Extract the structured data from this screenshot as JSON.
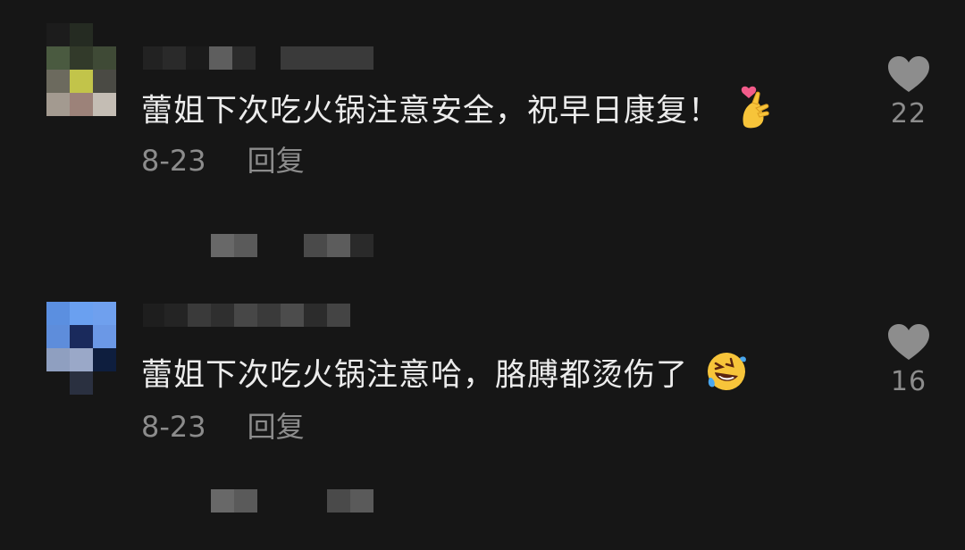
{
  "comments": [
    {
      "text": "蕾姐下次吃火锅注意安全，祝早日康复！",
      "emoji": "finger-heart-emoji",
      "date": "8-23",
      "reply_label": "回复",
      "like_count": "22"
    },
    {
      "text": "蕾姐下次吃火锅注意哈，胳膊都烫伤了",
      "emoji": "rolling-laughing-emoji",
      "date": "8-23",
      "reply_label": "回复",
      "like_count": "16"
    }
  ],
  "icons": {
    "like": "heart-icon"
  },
  "colors": {
    "background": "#161616",
    "text": "#ececec",
    "secondary_text": "#8c8c8c",
    "heart": "#8d8d8d"
  }
}
